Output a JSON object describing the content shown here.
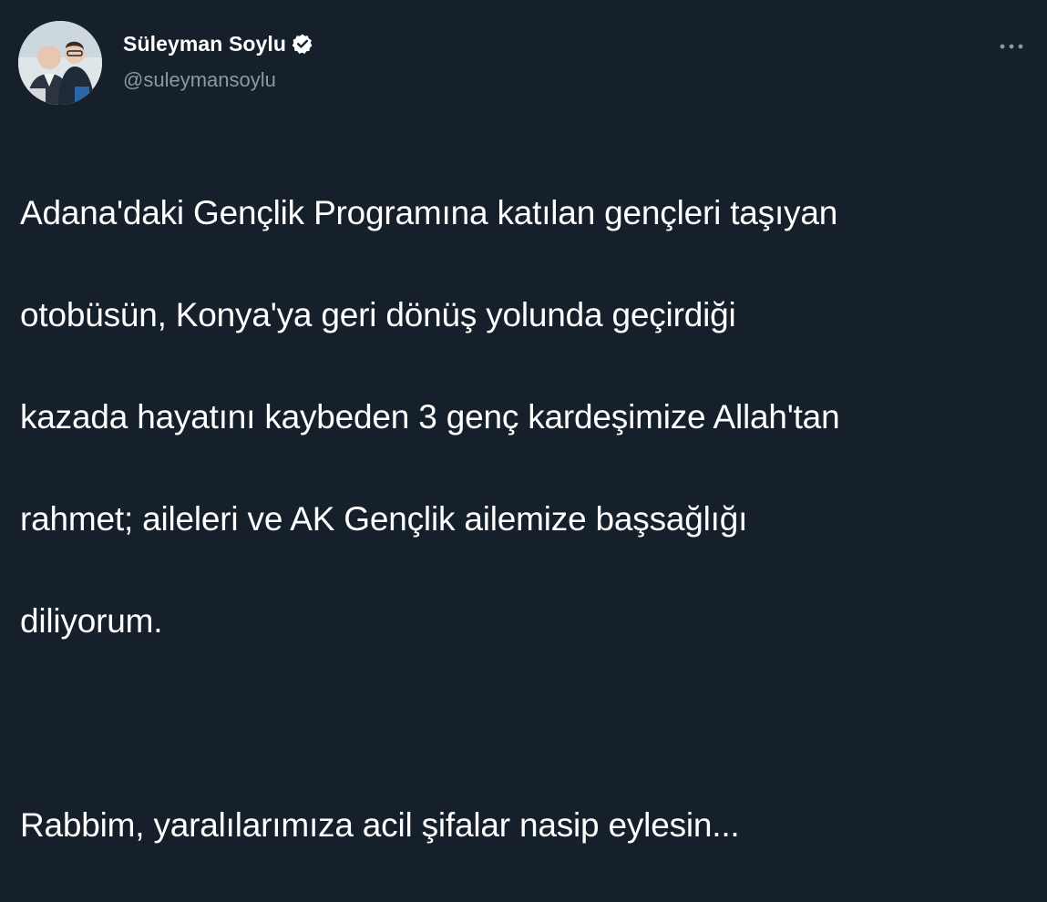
{
  "author": {
    "display_name": "Süleyman Soylu",
    "handle": "@suleymansoylu",
    "verified": true,
    "avatar_icon": "avatar-photo"
  },
  "tweet": {
    "paragraph_1_lines": [
      "Adana'daki Gençlik Programına katılan gençleri taşıyan",
      "otobüsün, Konya'ya geri dönüş yolunda geçirdiği",
      "kazada hayatını kaybeden 3 genç kardeşimize Allah'tan",
      "rahmet; aileleri ve AK Gençlik ailemize başsağlığı",
      "diliyorum."
    ],
    "paragraph_2": "Rabbim, yaralılarımıza acil şifalar nasip eylesin..."
  },
  "icons": {
    "verified": "verified-badge-icon",
    "more": "more-options-icon"
  },
  "colors": {
    "background": "#15202b",
    "text_primary": "#ffffff",
    "text_secondary": "#8b98a5"
  }
}
